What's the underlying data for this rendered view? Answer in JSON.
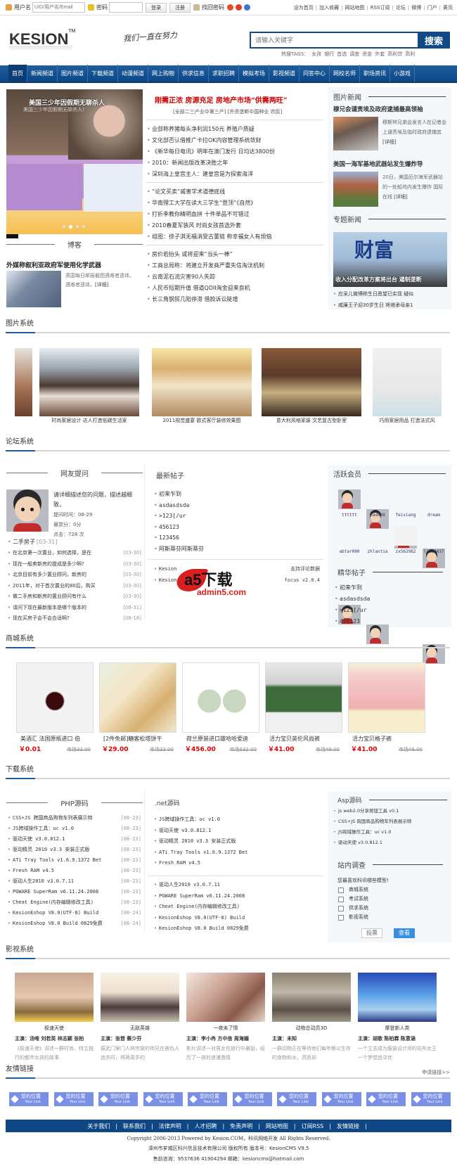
{
  "topbar": {
    "username_label": "用户名",
    "username_placeholder": "UID/用户名/Email",
    "password_label": "密码",
    "login_button": "登录",
    "register_button": "注册",
    "find_password": "找回密码",
    "links": [
      "设为首页",
      "加入收藏",
      "网站地图",
      "RSS订阅",
      "论坛",
      "微博",
      "门户",
      "黄页"
    ]
  },
  "header": {
    "logo": "KESION",
    "logo_tm": "TM",
    "slogan": "我们一直在努力",
    "search_placeholder": "请输入关键字",
    "search_button": "搜索",
    "hot_tags_label": "热搜TAGS：",
    "hot_tags": [
      "女孩",
      "银行",
      "首选",
      "调查",
      "资金",
      "外套",
      "高利贷",
      "高利"
    ]
  },
  "nav": [
    "首页",
    "新闻频道",
    "图片频道",
    "下载频道",
    "动漫频道",
    "网上购物",
    "供求信息",
    "求职招聘",
    "模拟考场",
    "影视频道",
    "问答中心",
    "网校名师",
    "职场资讯",
    "小游戏"
  ],
  "slider": {
    "caption": "美国三少年因假期无聊杀人",
    "subcaption": "美国三少年因假期无聊杀人！"
  },
  "blog": {
    "title": "博客",
    "headline": "外媒称叙利亚政府军使用化学武器",
    "summary": "英国每日邮报截图遇难者遗体。遇难者遗体。",
    "more": "[详细]"
  },
  "headlines": {
    "top_title": "刚需正浓 房源充足 房地产市场“供需两旺”",
    "top_sub": "[全部二三产业中第三产] [外资垄断中国种业 农民]",
    "group1": [
      "业部称养猪每头净利润150元 养殖户质疑",
      "文化部否认借推广卡拉OK内容管理系统敛财",
      "《新华每日电讯》明年在澳门发行 日均达3800份",
      "2010：新闻出版改革决胜之年",
      "深圳海上皇宫主人：建皇宫是为探索海洋"
    ],
    "group2": [
      "“论文买卖”威害学术道德底线",
      "华南理工大学在读大三学生“登顶”《自然》",
      "打折季教你精明血拼 十件单品不可错过",
      "2010春夏军装风 时尚女孩首选外套",
      "组图：徐子淇无福消受古董链 称幸福女人有烦恼"
    ],
    "group3": [
      "房价若抬头 或将迎来“当头一棒”",
      "工商总局称：将建立开发商严重失信淘汰机制",
      "云南泥石流灾害90人失踪",
      "人民币短期升值 借道QDII淘金迎来良机",
      "长三角钢贸几陷停滞 借款诉讼陡增"
    ]
  },
  "photo_news": {
    "title": "图片新闻",
    "items": [
      {
        "title": "穆兄会谴责埃及政府逮捕最高领袖",
        "summary": "穆斯林兄弟会发言人在记者会上谴责埃及临时政府逮捕其",
        "more": "[详细]"
      },
      {
        "title": "美国一海军基地武器站发生爆炸导",
        "summary": "20日，美国厄尔海军武器站的一处船坞内发生爆炸 国际在线",
        "more": "[详细]"
      }
    ]
  },
  "special_news": {
    "title": "专题新闻",
    "image_caption": "收入分配改革方案将出台 遏制垄断",
    "items": [
      "应采儿微博称生日愿望已实现 疑似",
      "威廉王子迎30岁生日 将继承母亲1"
    ]
  },
  "sections": {
    "pictures": "图片系统",
    "forum": "论坛系统",
    "shop": "商城系统",
    "download": "下载系统",
    "movies": "影视系统",
    "links": "友情链接",
    "apply_link": "申请链接>>"
  },
  "picture_system": [
    "时尚家居设计 达人打造低碳生活家",
    "2011视觉盛宴 欧式客厅装修效果图",
    "意大利风格家装 文艺复古型卧室",
    "巧用家居用品 打造法式风"
  ],
  "forum": {
    "ask_title": "网友提问",
    "question": "请详细描述您的问题，描述越细致，",
    "ask_time": "提问时间：08-29",
    "reward": "悬赏分：0分",
    "clicks": "点击：728 次",
    "first_item": "二手房子",
    "first_date": "[03-31]",
    "items": [
      {
        "t": "在北京第一次置业，如何选择，是在",
        "d": "[03-30]"
      },
      {
        "t": "现在一般卖新房的提成是多少啊?",
        "d": "[03-30]"
      },
      {
        "t": "北京目前有多少置业顾问，新房的",
        "d": "[03-30]"
      },
      {
        "t": "2011年，对于首次置业的80后，购买",
        "d": "[03-30]"
      },
      {
        "t": "做二手房和新房的置业顾问有什么",
        "d": "[03-30]"
      },
      {
        "t": "请问下现在最新版本是哪个版本的",
        "d": "[08-31]"
      },
      {
        "t": "现在买房子会不会合适啊?",
        "d": "[08-18]"
      }
    ],
    "latest_title": "最新帖子",
    "latest": [
      "初来乍到",
      "asdasdsda",
      ">123[/ur",
      "456123",
      "123456",
      "阿斯蒂芬阿斯蒂芬"
    ],
    "latest2": [
      {
        "t": "Kesion",
        "r": "支持评论数据"
      },
      {
        "t": "Kesion",
        "r": "focus v2.0.4"
      }
    ],
    "watermark": "a5下载",
    "watermark_url": "admin5.com",
    "active_title": "活跃会员",
    "members": [
      "tttttt",
      "had888",
      "feixiang",
      "dream",
      "abtar090",
      "zhlantia",
      "zx562982",
      "li254437"
    ],
    "elite_title": "精华帖子",
    "elite": [
      "初来乍到",
      "asdasdsda",
      ">123[/ur",
      "456123"
    ]
  },
  "shop": [
    {
      "name": "美酒汇 法国原瓶进口 伯",
      "price": "￥0.01",
      "market": "市场33.00"
    },
    {
      "name": "[2件免邮]糖客松塔饼干",
      "price": "￥29.00",
      "market": "市场33.00"
    },
    {
      "name": "荷兰原装进口雄哈哈爱迪",
      "price": "￥456.00",
      "market": "市场532.00"
    },
    {
      "name": "活力宝贝英伦风尚裤",
      "price": "￥41.00",
      "market": "市场49.00"
    },
    {
      "name": "活力宝贝格子裤",
      "price": "￥41.00",
      "market": "市场49.00"
    }
  ],
  "download": {
    "php_title": "PHP源码",
    "php": [
      {
        "t": "CSS+JS 跨国商品购物车列表展示特",
        "d": "[08-23]"
      },
      {
        "t": "JS跨域操作工具：uc v1.0",
        "d": "[08-23]"
      },
      {
        "t": "驱动天使 v3.0.812.1",
        "d": "[08-23]"
      },
      {
        "t": "驱动精灵 2010 v3.3 安装正式版",
        "d": "[08-23]"
      },
      {
        "t": "ATi Tray Tools v1.6.9.1372 Bet",
        "d": "[08-23]"
      },
      {
        "t": "Fresh RAM v4.5",
        "d": "[08-23]"
      },
      {
        "t": "驱动人生2010 v3.0.7.11",
        "d": "[08-23]"
      },
      {
        "t": "PGWARE SuperRam v6.11.24.2008",
        "d": "[08-23]"
      },
      {
        "t": "Cheat Engine(内存编辑修改工具)",
        "d": "[08-23]"
      },
      {
        "t": "KesionEshop V8.0(UTF-8) Build",
        "d": "[08-24]"
      },
      {
        "t": "KesionEshop V8.0 Build 0829免费",
        "d": "[08-24]"
      }
    ],
    "net_title": ".net源码",
    "net1": [
      "JS跨域操作工具：uc v1.0",
      "驱动天使 v3.0.812.1",
      "驱动精灵 2010 v3.3 安装正式版",
      "ATi Tray Tools v1.6.9.1372 Bet",
      "Fresh RAM v4.5"
    ],
    "net2": [
      "驱动人生2010 v3.0.7.11",
      "PGWARE SuperRam v6.11.24.2008",
      "Cheat Engine(内存编辑修改工具)",
      "KesionEshop V8.0(UTF-8) Build",
      "KesionEshop V8.0 Build 0829免费"
    ],
    "asp_title": "Asp源码",
    "asp": [
      "js web2.0分享按钮工具 v0.1",
      "CSS+JS 跨国商品购物车列表展示特",
      "JS跨域操作工具：uc v1.0",
      "驱动天使 v3.0.812.1"
    ]
  },
  "survey": {
    "title": "站内调查",
    "question": "您最喜欢科讯哪些模型!",
    "options": [
      "商城系统",
      "考试系统",
      "供求系统",
      "影视系统"
    ],
    "vote": "投票",
    "view": "查看"
  },
  "movies": [
    {
      "title": "极速天使",
      "actors": "主演：汤唯 刘若英 林志颖 张柏",
      "desc": "《极速天使》讲述一群时尚、特立独行的都市女孩的故事"
    },
    {
      "title": "无敌英雄",
      "actors": "主演：张晋 蔡少芬",
      "desc": "振武门掌门人林宗棠的师兄在被仇人追杀时，将两周岁的"
    },
    {
      "title": "一夜未了情",
      "actors": "主演：李小冉 方中信 周海媚",
      "desc": "影片讲述一对男女在旅行中邂逅，经历了一夜的浪漫激情"
    },
    {
      "title": "动物总动员3D",
      "actors": "主演：未知",
      "desc": "一群动物正在等待他们每年赖以生存的食物和水，然而却"
    },
    {
      "title": "摩登新人类",
      "actors": "主演：胡歌 陈柏霖 陈意涵",
      "desc": "一个立志成为服装设计师的花布女王 一个梦想追寻忧"
    }
  ],
  "friend_link": {
    "cn": "您的位置",
    "en": "Your Link",
    "count": 10
  },
  "footer": {
    "links": [
      "关于我们",
      "联系我们",
      "法律声明",
      "人才招聘",
      "免责声明",
      "网站地图",
      "订阅RSS",
      "友情链接"
    ],
    "copyright": "Copyright 2006-2013 Powered by Kesion.COM，科讯网络开发 All Rights Reserved.",
    "company": "漳州市芗城区科兴信息技术有限公司 版权所有 版本号：KesionCMS V9.5",
    "contact": "售前咨询：9537636 41904294 邮箱：kesioncms@hotmail.com"
  },
  "colors": {
    "brand": "#0f4a86",
    "price": "#dd0000",
    "headline": "#cc0000"
  }
}
